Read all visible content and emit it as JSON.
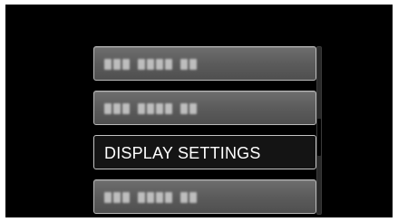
{
  "menu": {
    "items": [
      {
        "label": "",
        "state": "unselected",
        "obscured": true
      },
      {
        "label": "",
        "state": "unselected",
        "obscured": true
      },
      {
        "label": "DISPLAY SETTINGS",
        "state": "selected",
        "obscured": false
      },
      {
        "label": "",
        "state": "unselected",
        "obscured": true
      }
    ],
    "selected_index": 2
  },
  "scroll": {
    "position": 0.55
  },
  "colors": {
    "screen_background": "#000000",
    "item_background": "#5d5d5d",
    "selected_background": "#141414",
    "item_border": "#b9b9b9",
    "text": "#ffffff"
  }
}
